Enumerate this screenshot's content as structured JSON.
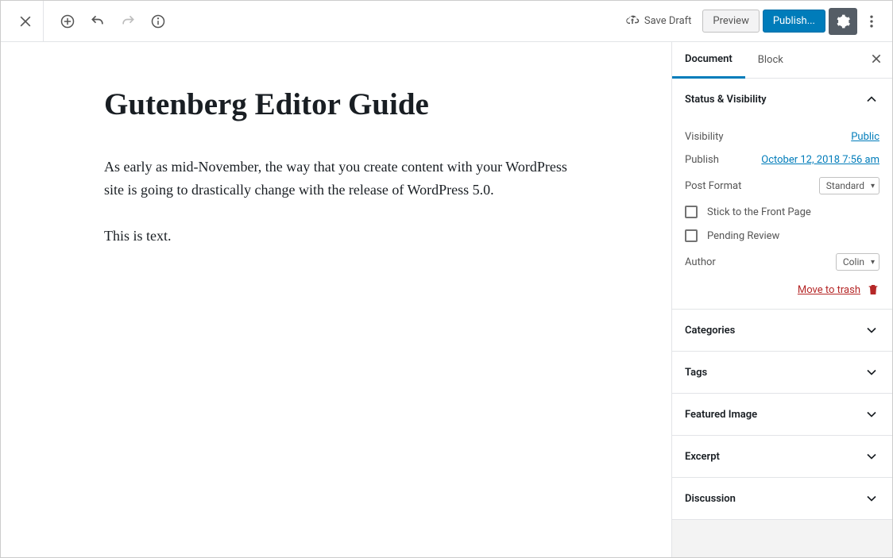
{
  "topbar": {
    "save_draft": "Save Draft",
    "preview": "Preview",
    "publish": "Publish..."
  },
  "editor": {
    "title": "Gutenberg Editor Guide",
    "para1": "As early as mid-November, the way that you create content with your WordPress site is going to drastically change with the release of WordPress 5.0.",
    "para2": "This is text."
  },
  "sidebar": {
    "tabs": {
      "document": "Document",
      "block": "Block"
    },
    "status": {
      "heading": "Status & Visibility",
      "visibility_label": "Visibility",
      "visibility_value": "Public",
      "publish_label": "Publish",
      "publish_value": "October 12, 2018 7:56 am",
      "post_format_label": "Post Format",
      "post_format_value": "Standard",
      "stick_label": "Stick to the Front Page",
      "pending_label": "Pending Review",
      "author_label": "Author",
      "author_value": "Colin",
      "trash_label": "Move to trash"
    },
    "panels": {
      "categories": "Categories",
      "tags": "Tags",
      "featured_image": "Featured Image",
      "excerpt": "Excerpt",
      "discussion": "Discussion"
    }
  }
}
